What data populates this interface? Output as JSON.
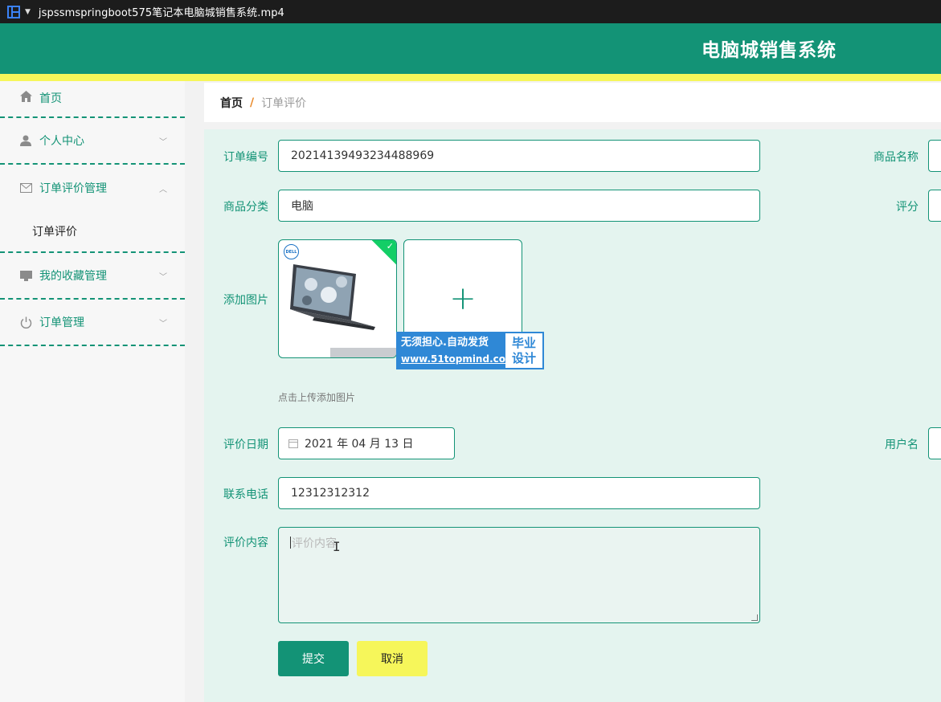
{
  "window": {
    "title": "jspssmspringboot575笔记本电脑城销售系统.mp4"
  },
  "header": {
    "system_title": "电脑城销售系统"
  },
  "sidebar": {
    "items": [
      {
        "label": "首页",
        "icon": "home-icon"
      },
      {
        "label": "个人中心",
        "icon": "user-icon"
      },
      {
        "label": "订单评价管理",
        "icon": "mail-icon",
        "submenu": [
          "订单评价"
        ]
      },
      {
        "label": "我的收藏管理",
        "icon": "monitor-icon"
      },
      {
        "label": "订单管理",
        "icon": "power-icon"
      }
    ]
  },
  "breadcrumb": {
    "home": "首页",
    "separator": "/",
    "current": "订单评价"
  },
  "form": {
    "order_no": {
      "label": "订单编号",
      "value": "20214139493234488969"
    },
    "product_name": {
      "label": "商品名称",
      "value": ""
    },
    "category": {
      "label": "商品分类",
      "value": "电脑"
    },
    "rating": {
      "label": "评分",
      "value": ""
    },
    "image": {
      "label": "添加图片",
      "hint": "点击上传添加图片",
      "thumb_brand": "DELL"
    },
    "review_date": {
      "label": "评价日期",
      "value": "2021 年 04 月 13 日"
    },
    "username": {
      "label": "用户名",
      "value": ""
    },
    "phone": {
      "label": "联系电话",
      "value": "12312312312"
    },
    "content": {
      "label": "评价内容",
      "placeholder": "评价内容"
    }
  },
  "watermark": {
    "line1": "无须担心.自动发货",
    "url": "www.51topmind.com",
    "side1": "毕业",
    "side2": "设计"
  },
  "buttons": {
    "submit": "提交",
    "cancel": "取消"
  },
  "colors": {
    "primary": "#139376",
    "accent": "#f6f65a",
    "form_bg": "#e4f4ef"
  }
}
